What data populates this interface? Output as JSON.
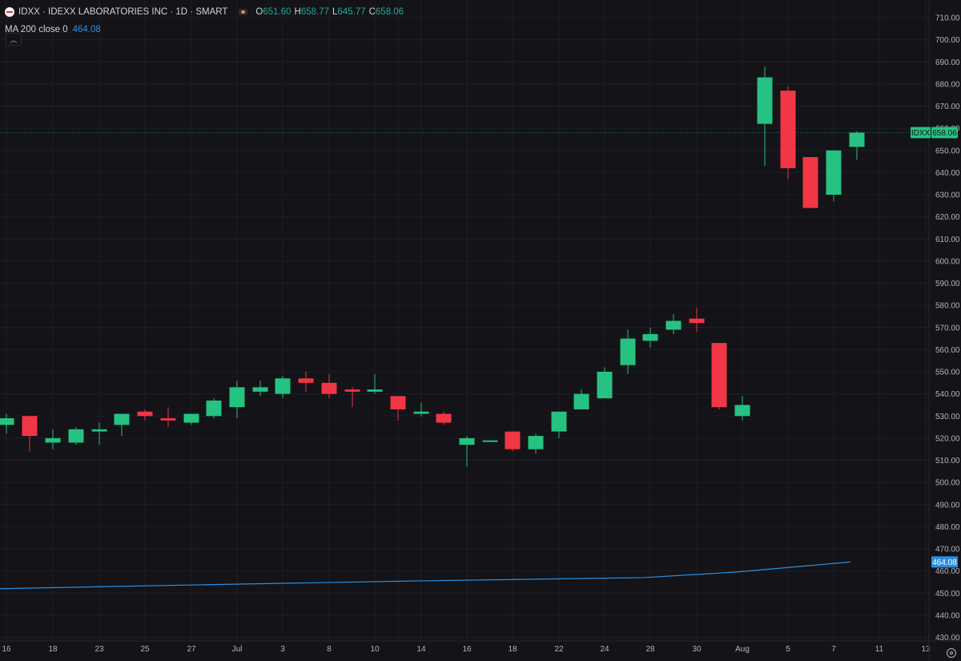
{
  "legend": {
    "title": "IDXX · IDEXX LABORATORIES INC · 1D · SMART",
    "open_label": "O",
    "open": "651.60",
    "high_label": "H",
    "high": "658.77",
    "low_label": "L",
    "low": "645.77",
    "close_label": "C",
    "close": "658.06",
    "ma_label": "MA 200 close 0",
    "ma_value": "464.08"
  },
  "colors": {
    "up": "#26c281",
    "down": "#f23645",
    "ma": "#2b8fe0",
    "grid": "#1e1e24",
    "background": "#131318"
  },
  "price_tag": {
    "symbol": "IDXX",
    "value": "658.06",
    "ma_value": "464.08"
  },
  "chart_data": {
    "type": "candlestick",
    "y_range": [
      425,
      715
    ],
    "y_ticks": [
      430,
      440,
      450,
      460,
      470,
      480,
      490,
      500,
      510,
      520,
      530,
      540,
      550,
      560,
      570,
      580,
      590,
      600,
      610,
      620,
      630,
      640,
      650,
      660,
      670,
      680,
      690,
      700,
      710
    ],
    "x_ticks": [
      "16",
      "18",
      "23",
      "25",
      "27",
      "Jul",
      "3",
      "8",
      "10",
      "12",
      "14",
      "16",
      "18",
      "22",
      "24",
      "26",
      "28",
      "30",
      "Aug",
      "5",
      "7",
      "9",
      "11",
      "13"
    ],
    "x_tick_labels_shown": [
      "16",
      "18",
      "23",
      "25",
      "27",
      "Jul",
      "3",
      "8",
      "10",
      "14",
      "16",
      "18",
      "22",
      "24",
      "28",
      "30",
      "Aug",
      "5",
      "7",
      "11",
      "13"
    ],
    "candles": [
      {
        "date": "Jun 14",
        "o": 526,
        "h": 531,
        "l": 522,
        "c": 529
      },
      {
        "date": "Jun 17",
        "o": 530,
        "h": 530,
        "l": 514,
        "c": 521
      },
      {
        "date": "Jun 18",
        "o": 518,
        "h": 524,
        "l": 515,
        "c": 520
      },
      {
        "date": "Jun 20",
        "o": 518,
        "h": 525,
        "l": 517,
        "c": 524
      },
      {
        "date": "Jun 21",
        "o": 523,
        "h": 527,
        "l": 517,
        "c": 524
      },
      {
        "date": "Jun 24",
        "o": 526,
        "h": 531,
        "l": 521,
        "c": 531
      },
      {
        "date": "Jun 25",
        "o": 532,
        "h": 533,
        "l": 528,
        "c": 530
      },
      {
        "date": "Jun 26",
        "o": 529,
        "h": 534,
        "l": 525,
        "c": 528
      },
      {
        "date": "Jun 27",
        "o": 527,
        "h": 531,
        "l": 526,
        "c": 531
      },
      {
        "date": "Jun 28",
        "o": 530,
        "h": 538,
        "l": 529,
        "c": 537
      },
      {
        "date": "Jul 1",
        "o": 534,
        "h": 546,
        "l": 529,
        "c": 543
      },
      {
        "date": "Jul 2",
        "o": 541,
        "h": 546,
        "l": 539,
        "c": 543
      },
      {
        "date": "Jul 3",
        "o": 540,
        "h": 548,
        "l": 538,
        "c": 547
      },
      {
        "date": "Jul 5",
        "o": 547,
        "h": 550,
        "l": 541,
        "c": 545
      },
      {
        "date": "Jul 8",
        "o": 545,
        "h": 549,
        "l": 538,
        "c": 540
      },
      {
        "date": "Jul 9",
        "o": 542,
        "h": 543,
        "l": 534,
        "c": 541
      },
      {
        "date": "Jul 10",
        "o": 541,
        "h": 549,
        "l": 540,
        "c": 542
      },
      {
        "date": "Jul 11",
        "o": 539,
        "h": 539,
        "l": 528,
        "c": 533
      },
      {
        "date": "Jul 12",
        "o": 531,
        "h": 536,
        "l": 530,
        "c": 532
      },
      {
        "date": "Jul 15",
        "o": 531,
        "h": 532,
        "l": 526,
        "c": 527
      },
      {
        "date": "Jul 16",
        "o": 517,
        "h": 521,
        "l": 507,
        "c": 520
      },
      {
        "date": "Jul 17",
        "o": 519,
        "h": 519,
        "l": 519,
        "c": 519
      },
      {
        "date": "Jul 18",
        "o": 523,
        "h": 523,
        "l": 514,
        "c": 515
      },
      {
        "date": "Jul 19",
        "o": 515,
        "h": 522,
        "l": 513,
        "c": 521
      },
      {
        "date": "Jul 22",
        "o": 523,
        "h": 532,
        "l": 520,
        "c": 532
      },
      {
        "date": "Jul 23",
        "o": 533,
        "h": 542,
        "l": 533,
        "c": 540
      },
      {
        "date": "Jul 24",
        "o": 538,
        "h": 552,
        "l": 538,
        "c": 550
      },
      {
        "date": "Jul 25",
        "o": 553,
        "h": 569,
        "l": 549,
        "c": 565
      },
      {
        "date": "Jul 26",
        "o": 564,
        "h": 570,
        "l": 561,
        "c": 567
      },
      {
        "date": "Jul 29",
        "o": 569,
        "h": 576,
        "l": 567,
        "c": 573
      },
      {
        "date": "Jul 30",
        "o": 574,
        "h": 579,
        "l": 568,
        "c": 572
      },
      {
        "date": "Jul 31",
        "o": 563,
        "h": 563,
        "l": 533,
        "c": 534
      },
      {
        "date": "Aug 1",
        "o": 530,
        "h": 539,
        "l": 528,
        "c": 535
      },
      {
        "date": "Aug 2",
        "o": 662,
        "h": 688,
        "l": 643,
        "c": 683
      },
      {
        "date": "Aug 5",
        "o": 677,
        "h": 679,
        "l": 637,
        "c": 642
      },
      {
        "date": "Aug 6",
        "o": 647,
        "h": 647,
        "l": 624,
        "c": 624
      },
      {
        "date": "Aug 7",
        "o": 630,
        "h": 650,
        "l": 627,
        "c": 650
      },
      {
        "date": "Aug 8",
        "o": 651.6,
        "h": 658.77,
        "l": 645.77,
        "c": 658.06
      }
    ],
    "ma200": [
      {
        "date": "Jun 14",
        "v": 452.0
      },
      {
        "date": "Jun 28",
        "v": 453.8
      },
      {
        "date": "Jul 12",
        "v": 455.5
      },
      {
        "date": "Jul 26",
        "v": 457.0
      },
      {
        "date": "Aug 1",
        "v": 459.5
      },
      {
        "date": "Aug 8",
        "v": 464.08
      }
    ]
  }
}
